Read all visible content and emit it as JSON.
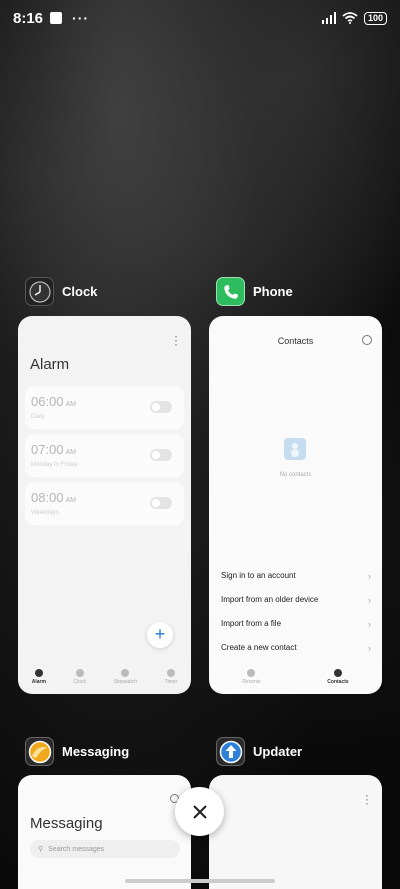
{
  "status_bar": {
    "time": "8:16",
    "dots": "···",
    "battery": "100"
  },
  "apps": {
    "clock": {
      "name": "Clock",
      "title": "Alarm",
      "alarms": [
        {
          "time": "06:00",
          "ampm": "AM",
          "sub": "Daily"
        },
        {
          "time": "07:00",
          "ampm": "AM",
          "sub": "Monday to Friday"
        },
        {
          "time": "08:00",
          "ampm": "AM",
          "sub": "Weekdays"
        }
      ],
      "fab": "+",
      "nav": [
        "Alarm",
        "Clock",
        "Stopwatch",
        "Timer"
      ]
    },
    "phone": {
      "name": "Phone",
      "title": "Contacts",
      "empty_text": "No contacts",
      "actions": [
        "Sign in to an account",
        "Import from an older device",
        "Import from a file",
        "Create a new contact"
      ],
      "nav": [
        "Recents",
        "Contacts"
      ]
    },
    "messaging": {
      "name": "Messaging",
      "title": "Messaging",
      "search_placeholder": "Search messages"
    },
    "updater": {
      "name": "Updater"
    }
  },
  "close_button": "✕",
  "icons": [
    "clock-icon",
    "phone-icon",
    "messaging-icon",
    "updater-icon",
    "settings-icon",
    "search-icon",
    "close-icon"
  ]
}
